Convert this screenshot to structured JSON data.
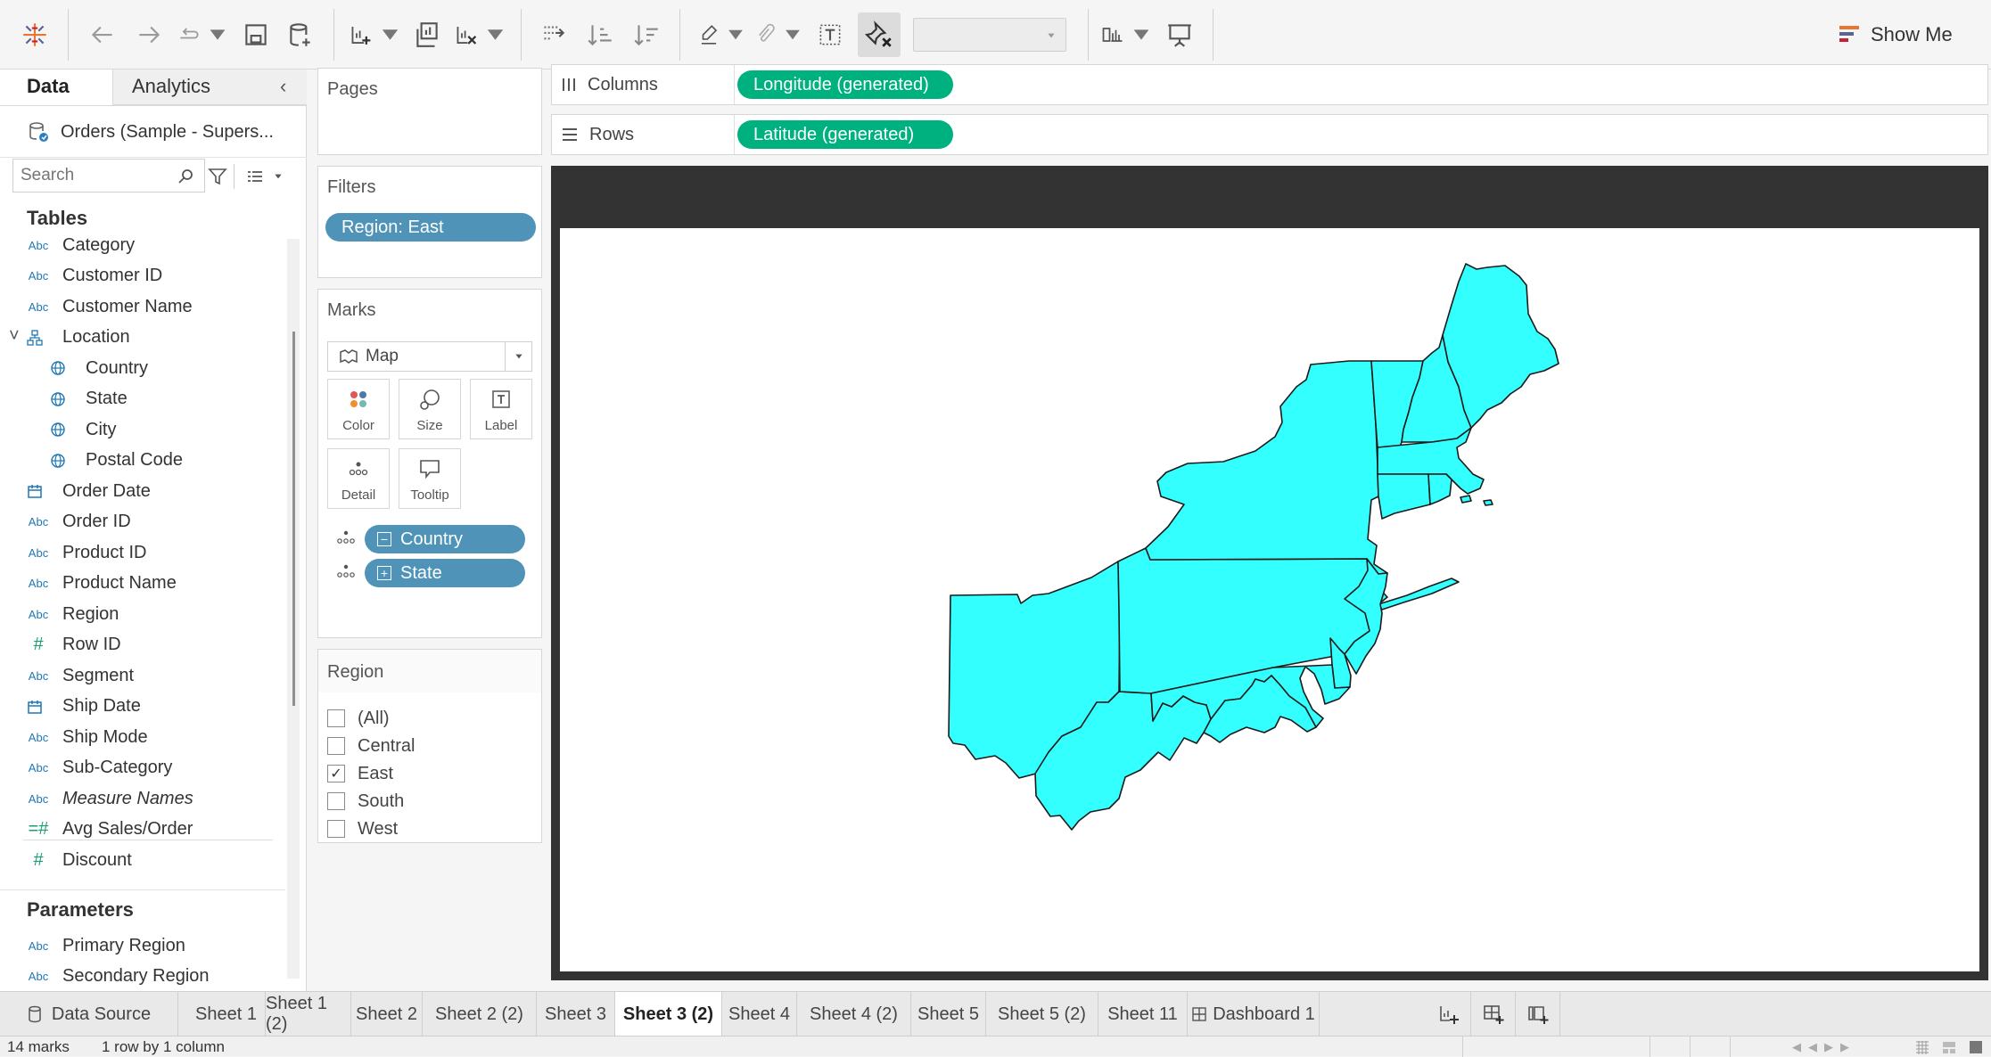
{
  "toolbar": {
    "show_me_label": "Show Me",
    "icons": [
      "tableau-logo-icon",
      "undo-icon",
      "redo-icon",
      "replay-icon",
      "save-icon",
      "new-datasource-icon",
      "new-worksheet-icon",
      "duplicate-sheet-icon",
      "clear-sheet-icon",
      "swap-icon",
      "sort-ascending-icon",
      "sort-descending-icon",
      "highlight-icon",
      "annotate-icon",
      "show-labels-icon",
      "pin-clear-icon",
      "fit-dropdown",
      "show-cards-icon",
      "presentation-icon"
    ]
  },
  "data_pane": {
    "tab_data": "Data",
    "tab_analytics": "Analytics",
    "datasource": "Orders (Sample - Supers...",
    "search_placeholder": "Search",
    "tables_title": "Tables",
    "fields": [
      {
        "type": "Abc",
        "name": "Category"
      },
      {
        "type": "Abc",
        "name": "Customer ID"
      },
      {
        "type": "Abc",
        "name": "Customer Name"
      },
      {
        "type": "hier",
        "name": "Location"
      },
      {
        "type": "geo",
        "name": "Country"
      },
      {
        "type": "geo",
        "name": "State"
      },
      {
        "type": "geo",
        "name": "City"
      },
      {
        "type": "geo",
        "name": "Postal Code"
      },
      {
        "type": "date",
        "name": "Order Date"
      },
      {
        "type": "Abc",
        "name": "Order ID"
      },
      {
        "type": "Abc",
        "name": "Product ID"
      },
      {
        "type": "Abc",
        "name": "Product Name"
      },
      {
        "type": "Abc",
        "name": "Region"
      },
      {
        "type": "#",
        "name": "Row ID"
      },
      {
        "type": "Abc",
        "name": "Segment"
      },
      {
        "type": "date",
        "name": "Ship Date"
      },
      {
        "type": "Abc",
        "name": "Ship Mode"
      },
      {
        "type": "Abc",
        "name": "Sub-Category"
      },
      {
        "type": "Abc",
        "name": "Measure Names"
      },
      {
        "type": "=#",
        "name": "Avg Sales/Order"
      },
      {
        "type": "#",
        "name": "Discount"
      }
    ],
    "parameters_title": "Parameters",
    "parameters": [
      {
        "type": "Abc",
        "name": "Primary Region"
      },
      {
        "type": "Abc",
        "name": "Secondary Region"
      }
    ]
  },
  "shelves": {
    "pages_title": "Pages",
    "filters_title": "Filters",
    "filter_pill": "Region: East",
    "marks_title": "Marks",
    "mark_type": "Map",
    "mark_buttons": [
      "Color",
      "Size",
      "Label",
      "Detail",
      "Tooltip"
    ],
    "detail_pills": [
      "Country",
      "State"
    ],
    "columns_label": "Columns",
    "columns_pill": "Longitude (generated)",
    "rows_label": "Rows",
    "rows_pill": "Latitude (generated)"
  },
  "region_filter": {
    "title": "Region",
    "options": [
      {
        "label": "(All)",
        "checked": false
      },
      {
        "label": "Central",
        "checked": false
      },
      {
        "label": "East",
        "checked": true
      },
      {
        "label": "South",
        "checked": false
      },
      {
        "label": "West",
        "checked": false
      }
    ]
  },
  "map": {
    "fill": "#33ffff",
    "stroke": "#1a1a1a",
    "title_bar_color": "#333333"
  },
  "tabs": {
    "datasource": "Data Source",
    "sheets": [
      "Sheet 1",
      "Sheet 1 (2)",
      "Sheet 2",
      "Sheet 2 (2)",
      "Sheet 3",
      "Sheet 3 (2)",
      "Sheet 4",
      "Sheet 4 (2)",
      "Sheet 5",
      "Sheet 5 (2)",
      "Sheet 11",
      "Dashboard 1"
    ],
    "active": "Sheet 3 (2)"
  },
  "status": {
    "marks": "14 marks",
    "rows": "1 row by 1 column"
  }
}
